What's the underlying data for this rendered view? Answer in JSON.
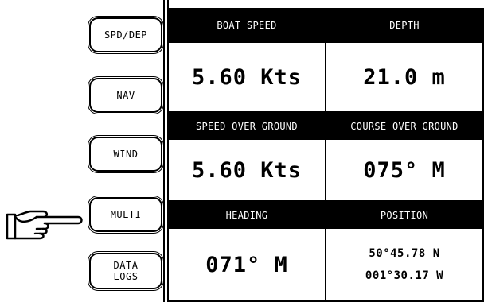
{
  "menu": {
    "buttons": [
      {
        "label": "SPD/DEP",
        "selected": false
      },
      {
        "label": "NAV",
        "selected": false
      },
      {
        "label": "WIND",
        "selected": false
      },
      {
        "label": "MULTI",
        "selected": true
      },
      {
        "label": "DATA\nLOGS",
        "selected": false
      }
    ],
    "pointer_icon": "pointing-hand-icon"
  },
  "panels": {
    "boat_speed": {
      "title": "BOAT SPEED",
      "value": "5.60 Kts"
    },
    "depth": {
      "title": "DEPTH",
      "value": "21.0 m"
    },
    "sog": {
      "title": "SPEED OVER GROUND",
      "value": "5.60 Kts"
    },
    "cog": {
      "title": "COURSE OVER GROUND",
      "value": "075° M"
    },
    "heading": {
      "title": "HEADING",
      "value": "071° M"
    },
    "position": {
      "title": "POSITION",
      "lat": "50°45.78 N",
      "lon": "001°30.17 W"
    }
  },
  "colors": {
    "background": "#ffffff",
    "header": "#000000",
    "text": "#000000"
  }
}
